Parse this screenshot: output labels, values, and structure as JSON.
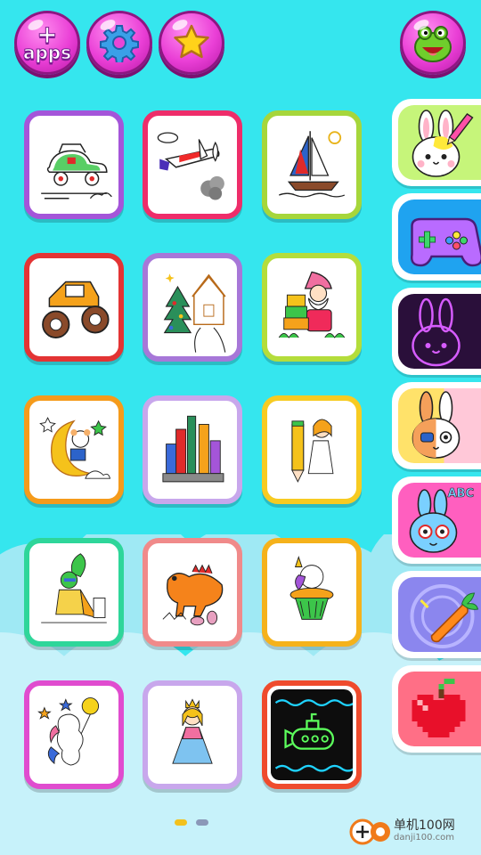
{
  "top_bar": {
    "apps_button": {
      "plus": "+",
      "label": "apps"
    },
    "settings_icon": "gear-icon",
    "favorites_icon": "star-icon",
    "character_icon": "om-nom-icon"
  },
  "colors": {
    "background": "#35e6ee",
    "button_pink": "#ea3fd6",
    "dot_active": "#f3c11c",
    "dot_inactive": "#8b98b8"
  },
  "coloring_pages": [
    {
      "name": "car",
      "frame_color": "#a455d9"
    },
    {
      "name": "airplane",
      "frame_color": "#ee2d6a"
    },
    {
      "name": "sailboat",
      "frame_color": "#a6d63b"
    },
    {
      "name": "monster-truck",
      "frame_color": "#e33434"
    },
    {
      "name": "winter-house",
      "frame_color": "#a777d8"
    },
    {
      "name": "gift-gnome",
      "frame_color": "#b4dd3b"
    },
    {
      "name": "moon-bear",
      "frame_color": "#f59b1b"
    },
    {
      "name": "castle",
      "frame_color": "#c8a7ec"
    },
    {
      "name": "pencil-girl",
      "frame_color": "#f7cb22"
    },
    {
      "name": "superhero",
      "frame_color": "#2ed69a"
    },
    {
      "name": "dinosaur",
      "frame_color": "#f08a8a"
    },
    {
      "name": "unicorn-cupcake",
      "frame_color": "#f5b21b"
    },
    {
      "name": "unicorn-balloon",
      "frame_color": "#e04ccf"
    },
    {
      "name": "princess",
      "frame_color": "#c8a7ec"
    },
    {
      "name": "glow-submarine",
      "frame_color": "#ef4b2d"
    }
  ],
  "side_categories": [
    {
      "name": "coloring-bunny",
      "bg": "#c6f57a"
    },
    {
      "name": "games",
      "bg": "#1fa3f0"
    },
    {
      "name": "glow-bunny",
      "bg": "#2a0f3a"
    },
    {
      "name": "pirate-bunny",
      "bg": "#fff26a"
    },
    {
      "name": "abc-bunny",
      "bg": "#ff5fbf"
    },
    {
      "name": "carrot-game",
      "bg": "#8b86ee"
    },
    {
      "name": "pixel-apple",
      "bg": "#ff6f86"
    }
  ],
  "side_labels": {
    "abc": "ABC"
  },
  "pagination": {
    "current": 1,
    "total": 2
  },
  "watermark": {
    "cn": "单机100网",
    "url": "danji100.com"
  }
}
